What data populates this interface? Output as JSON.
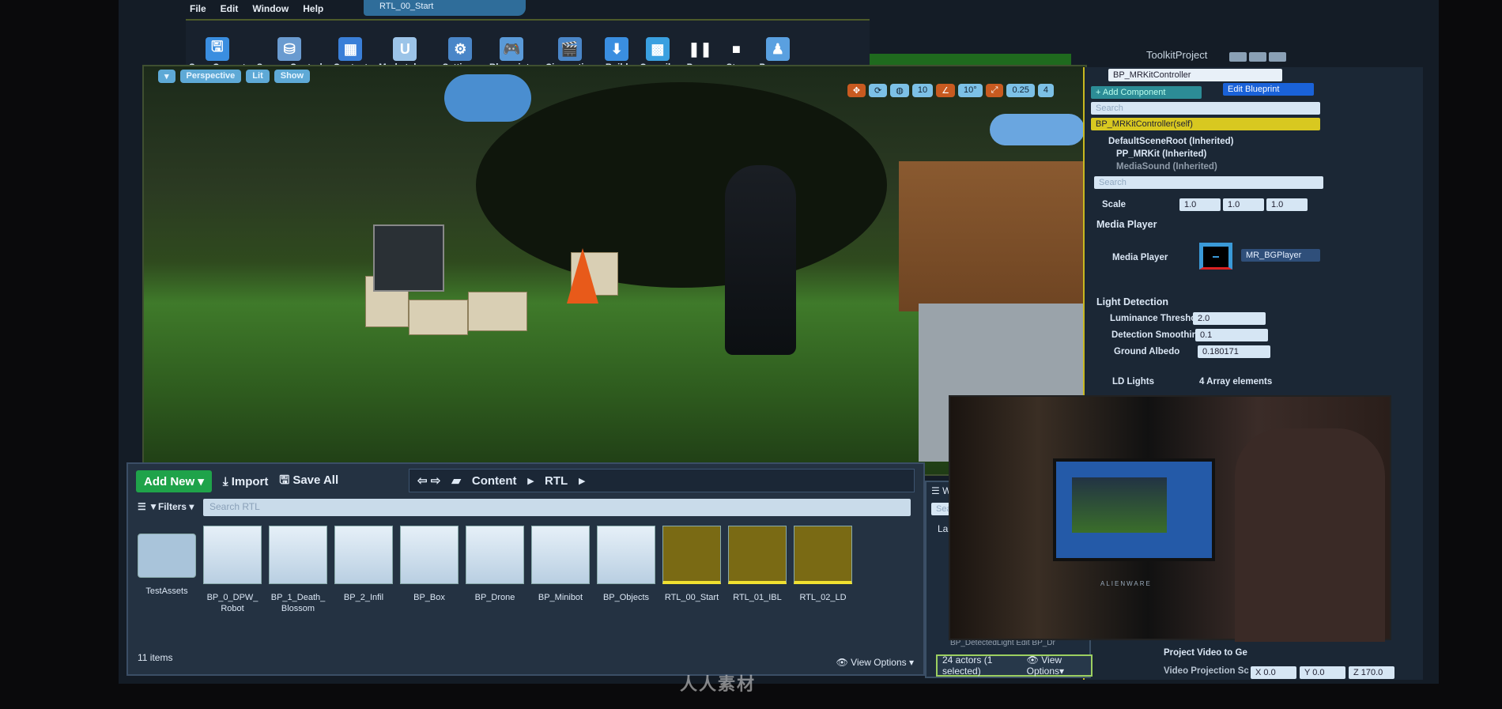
{
  "menu": {
    "items": [
      "File",
      "Edit",
      "Window",
      "Help"
    ]
  },
  "document_tab": "RTL_00_Start",
  "project_name": "ToolkitProject",
  "toolbar": {
    "buttons": [
      {
        "label": "Save Current",
        "icon": "floppy-icon",
        "color": "#3a8ee0"
      },
      {
        "label": "Source Control",
        "icon": "source-control-icon",
        "color": "#6a9bd0"
      },
      {
        "label": "Content",
        "icon": "content-grid-icon",
        "color": "#3a7fd8"
      },
      {
        "label": "Marketplace",
        "icon": "marketplace-icon",
        "color": "#9cc4e8"
      },
      {
        "label": "Settings",
        "icon": "gear-icon",
        "color": "#4a86c8"
      },
      {
        "label": "Blueprints",
        "icon": "gamepad-icon",
        "color": "#5a9ad8"
      },
      {
        "label": "Cinematics",
        "icon": "clapper-icon",
        "color": "#4a86c8"
      },
      {
        "label": "Build",
        "icon": "build-icon",
        "color": "#3a8ee0"
      },
      {
        "label": "Compile",
        "icon": "compile-icon",
        "color": "#3aa0e0"
      },
      {
        "label": "Pause",
        "icon": "pause-icon",
        "color": "#ffffff"
      },
      {
        "label": "Stop",
        "icon": "stop-icon",
        "color": "#ffffff"
      },
      {
        "label": "Possess",
        "icon": "possess-icon",
        "color": "#5aa0e0"
      }
    ]
  },
  "viewport": {
    "perspective": "Perspective",
    "lit": "Lit",
    "show": "Show",
    "grid_snap": "10",
    "rotation_snap": "10°",
    "scale_snap": "0.25",
    "camera_speed": "4"
  },
  "details": {
    "actor_name": "BP_MRKitController",
    "add_component": "+ Add Component",
    "edit_blueprint": "Edit Blueprint",
    "search_placeholder": "Search",
    "components": [
      "BP_MRKitController(self)",
      "DefaultSceneRoot (Inherited)",
      "PP_MRKit (Inherited)",
      "MediaSound (Inherited)"
    ],
    "scale_label": "Scale",
    "scale": [
      "1.0",
      "1.0",
      "1.0"
    ],
    "media_player_section": "Media Player",
    "media_player_label": "Media Player",
    "media_player_value": "MR_BGPlayer",
    "light_detection_section": "Light Detection",
    "luminance_label": "Luminance Threshc",
    "luminance_value": "2.0",
    "smoothing_label": "Detection Smoothin",
    "smoothing_value": "0.1",
    "albedo_label": "Ground Albedo",
    "albedo_value": "0.180171",
    "ld_lights_label": "LD Lights",
    "ld_lights_value": "4 Array elements",
    "project_video_label": "Project Video to Ge",
    "video_projection_label": "Video Projection Sc",
    "video_projection": [
      "X 0.0",
      "Y 0.0",
      "Z 170.0"
    ]
  },
  "content_browser": {
    "add_new": "Add New",
    "import": "Import",
    "save_all": "Save All",
    "breadcrumb": [
      "Content",
      "RTL"
    ],
    "filters": "Filters",
    "search_placeholder": "Search RTL",
    "assets": [
      {
        "name": "TestAssets",
        "type": "folder"
      },
      {
        "name": "BP_0_DPW_ Robot",
        "type": "blueprint"
      },
      {
        "name": "BP_1_Death_ Blossom",
        "type": "blueprint"
      },
      {
        "name": "BP_2_Infil",
        "type": "blueprint"
      },
      {
        "name": "BP_Box",
        "type": "blueprint"
      },
      {
        "name": "BP_Drone",
        "type": "blueprint"
      },
      {
        "name": "BP_Minibot",
        "type": "blueprint"
      },
      {
        "name": "BP_Objects",
        "type": "blueprint"
      },
      {
        "name": "RTL_00_Start",
        "type": "level"
      },
      {
        "name": "RTL_01_IBL",
        "type": "level"
      },
      {
        "name": "RTL_02_LD",
        "type": "level"
      }
    ],
    "item_count": "11 items",
    "view_options": "View Options"
  },
  "outliner": {
    "tab": "Wo",
    "search_placeholder": "Searc",
    "column": "Lab",
    "partial_row": "BP_DetectedLight  Edit BP_Dr",
    "status": "24 actors (1 selected)",
    "view_options": "View Options"
  },
  "camera_inset": {
    "laptop_brand": "ALIENWARE"
  },
  "watermark": "人人素材"
}
